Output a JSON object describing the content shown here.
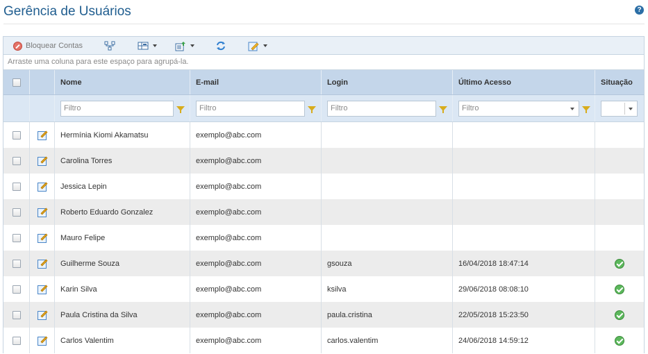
{
  "page": {
    "title": "Gerência de Usuários",
    "help_icon": "help-icon",
    "help_glyph": "?"
  },
  "toolbar": {
    "block_label": "Bloquear Contas",
    "block_icon": "block-icon",
    "hierarchy_icon": "hierarchy-icon",
    "columns_icon": "columns-icon",
    "export_icon": "export-icon",
    "refresh_icon": "refresh-icon",
    "edit_menu_icon": "edit-menu-icon"
  },
  "grid": {
    "group_hint": "Arraste uma coluna para este espaço para agrupá-la.",
    "columns": {
      "nome": "Nome",
      "email": "E-mail",
      "login": "Login",
      "ultimo_acesso": "Último Acesso",
      "situacao": "Situação"
    },
    "filter_placeholder": "Filtro",
    "rows": [
      {
        "nome": "Hermínia Kiomi Akamatsu",
        "email": "exemplo@abc.com",
        "login": "",
        "ultimo_acesso": "",
        "status": ""
      },
      {
        "nome": "Carolina Torres",
        "email": "exemplo@abc.com",
        "login": "",
        "ultimo_acesso": "",
        "status": ""
      },
      {
        "nome": "Jessica Lepin",
        "email": "exemplo@abc.com",
        "login": "",
        "ultimo_acesso": "",
        "status": ""
      },
      {
        "nome": "Roberto Eduardo Gonzalez",
        "email": "exemplo@abc.com",
        "login": "",
        "ultimo_acesso": "",
        "status": ""
      },
      {
        "nome": "Mauro Felipe",
        "email": "exemplo@abc.com",
        "login": "",
        "ultimo_acesso": "",
        "status": ""
      },
      {
        "nome": "Guilherme Souza",
        "email": "exemplo@abc.com",
        "login": "gsouza",
        "ultimo_acesso": "16/04/2018 18:47:14",
        "status": "active"
      },
      {
        "nome": "Karin Silva",
        "email": "exemplo@abc.com",
        "login": "ksilva",
        "ultimo_acesso": "29/06/2018 08:08:10",
        "status": "active"
      },
      {
        "nome": "Paula Cristina da Silva",
        "email": "exemplo@abc.com",
        "login": "paula.cristina",
        "ultimo_acesso": "22/05/2018 15:23:50",
        "status": "active"
      },
      {
        "nome": "Carlos Valentim",
        "email": "exemplo@abc.com",
        "login": "carlos.valentim",
        "ultimo_acesso": "24/06/2018 14:59:12",
        "status": "active"
      }
    ]
  },
  "colors": {
    "title": "#1f5d8f",
    "header_bg": "#c4d6ea",
    "filter_bg": "#dbe7f4",
    "toolbar_bg": "#e9f0f7",
    "status_ok": "#5cb85c"
  }
}
